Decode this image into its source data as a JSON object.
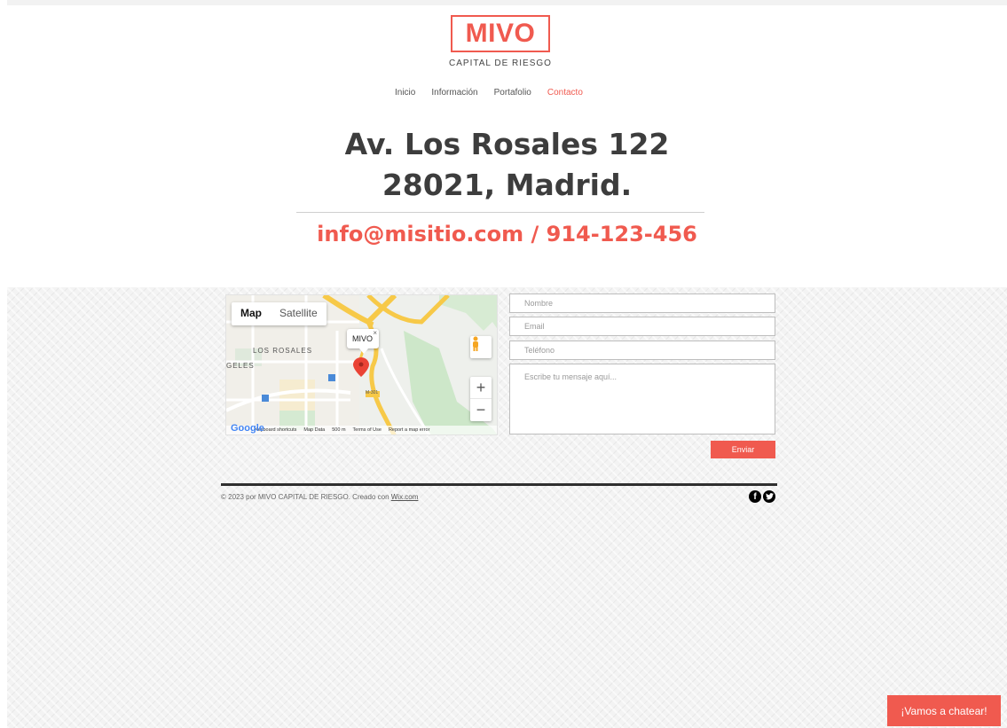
{
  "header": {
    "logo": "MIVO",
    "logo_subtitle": "CAPITAL DE RIESGO"
  },
  "nav": {
    "items": [
      "Inicio",
      "Información",
      "Portafolio",
      "Contacto"
    ],
    "active": "Contacto"
  },
  "main": {
    "address_line1": "Av. Los Rosales 122",
    "address_line2": "28021, Madrid.",
    "contact": "info@misitio.com / 914-123-456"
  },
  "map": {
    "tab_map": "Map",
    "tab_satellite": "Satellite",
    "marker_label": "MIVO",
    "close_glyph": "×",
    "zoom_in": "+",
    "zoom_out": "−",
    "area_label_1": "LOS ROSALES",
    "area_label_2": "GELES",
    "road_label": "M-301",
    "footer_items": [
      "Keyboard shortcuts",
      "Map Data",
      "500 m",
      "Terms of Use",
      "Report a map error"
    ],
    "google": "Google"
  },
  "form": {
    "name_placeholder": "Nombre",
    "email_placeholder": "Email",
    "phone_placeholder": "Teléfono",
    "message_placeholder": "Escribe tu mensaje aquí...",
    "submit_label": "Enviar"
  },
  "footer": {
    "copyright_text": "© 2023 por MIVO CAPITAL DE RIESGO. Creado con ",
    "link_text": "Wix.com",
    "social_icons": [
      "facebook-icon",
      "twitter-icon"
    ]
  },
  "chat": {
    "label": "¡Vamos a chatear!"
  },
  "colors": {
    "accent": "#f05a4f",
    "text_dark": "#3d3d3d",
    "footer_rule": "#2f2f2f"
  }
}
